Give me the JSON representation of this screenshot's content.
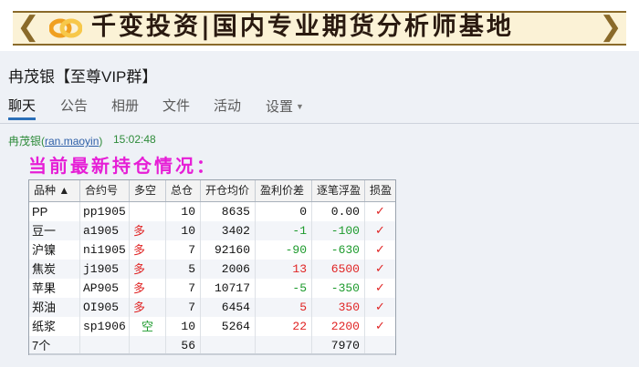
{
  "banner": {
    "text": "千变投资|国内专业期货分析师基地",
    "colors": {
      "bg": "#fbf2d6",
      "border": "#8a6a2a",
      "logo": "#f0a020"
    },
    "logo_icon": "chain-link-logo"
  },
  "chat": {
    "title": "冉茂银【至尊VIP群】",
    "tabs": [
      "聊天",
      "公告",
      "相册",
      "文件",
      "活动",
      "设置"
    ],
    "active_tab": "聊天",
    "accent": "#2a6fb8"
  },
  "message": {
    "sender_name": "冉茂银",
    "sender_id": "ran.maoyin",
    "time": "15:02:48",
    "headline": "当前最新持仓情况：",
    "headline_color": "#e61ed6"
  },
  "table": {
    "columns": [
      "品种 ▲",
      "合约号",
      "多空",
      "总仓",
      "开仓均价",
      "盈利价差",
      "逐笔浮盈",
      "损盈"
    ],
    "rows": [
      {
        "product": "PP",
        "contract": "pp1905",
        "dir": "",
        "size": "10",
        "price": "8635",
        "diff": "0",
        "pnl": "0.00",
        "diff_sign": "zero",
        "mark": "✓"
      },
      {
        "product": "豆一",
        "contract": "a1905",
        "dir": "多",
        "size": "10",
        "price": "3402",
        "diff": "-1",
        "pnl": "-100",
        "diff_sign": "neg",
        "mark": "✓"
      },
      {
        "product": "沪镍",
        "contract": "ni1905",
        "dir": "多",
        "size": "7",
        "price": "92160",
        "diff": "-90",
        "pnl": "-630",
        "diff_sign": "neg",
        "mark": "✓"
      },
      {
        "product": "焦炭",
        "contract": "j1905",
        "dir": "多",
        "size": "5",
        "price": "2006",
        "diff": "13",
        "pnl": "6500",
        "diff_sign": "pos",
        "mark": "✓"
      },
      {
        "product": "苹果",
        "contract": "AP905",
        "dir": "多",
        "size": "7",
        "price": "10717",
        "diff": "-5",
        "pnl": "-350",
        "diff_sign": "neg",
        "mark": "✓"
      },
      {
        "product": "郑油",
        "contract": "OI905",
        "dir": "多",
        "size": "7",
        "price": "6454",
        "diff": "5",
        "pnl": "350",
        "diff_sign": "pos",
        "mark": "✓"
      },
      {
        "product": "纸浆",
        "contract": "sp1906",
        "dir": "空",
        "size": "10",
        "price": "5264",
        "diff": "22",
        "pnl": "2200",
        "diff_sign": "pos",
        "mark": "✓"
      }
    ],
    "summary": {
      "product": "7个",
      "size": "56",
      "pnl": "7970"
    },
    "colors": {
      "long": "#e02424",
      "short": "#1c9a2c",
      "profit": "#e02424",
      "loss": "#1c9a2c"
    }
  }
}
